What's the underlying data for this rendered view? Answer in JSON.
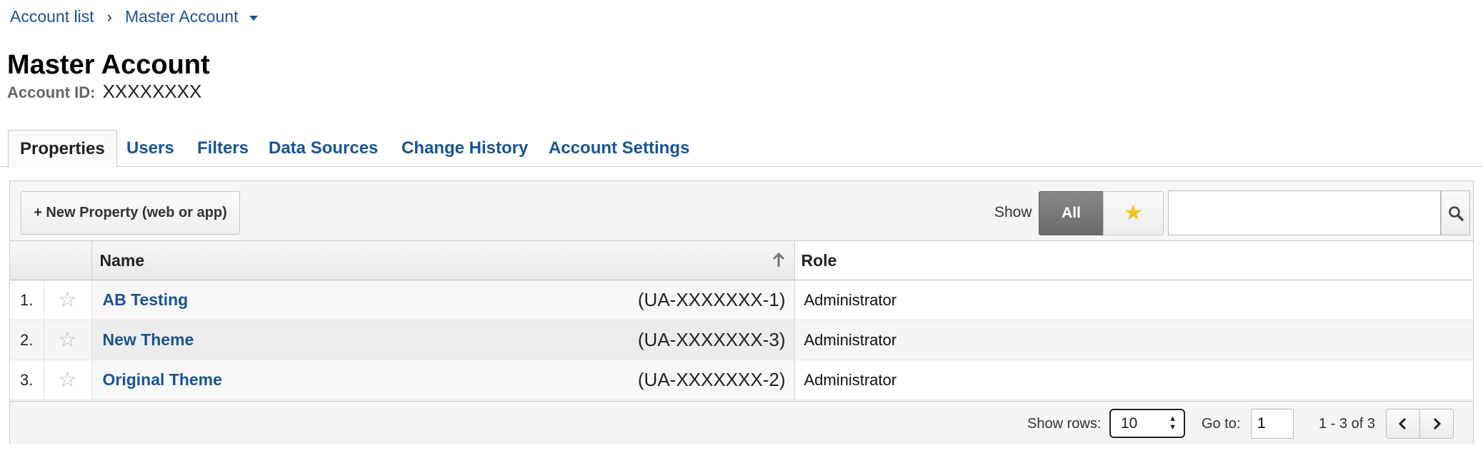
{
  "breadcrumb": {
    "account_list": "Account list",
    "separator": "›",
    "current": "Master Account"
  },
  "header": {
    "title": "Master Account",
    "account_id_label": "Account ID:",
    "account_id_value": "XXXXXXXX"
  },
  "tabs": [
    {
      "label": "Properties",
      "active": true
    },
    {
      "label": "Users",
      "active": false
    },
    {
      "label": "Filters",
      "active": false
    },
    {
      "label": "Data Sources",
      "active": false
    },
    {
      "label": "Change History",
      "active": false
    },
    {
      "label": "Account Settings",
      "active": false
    }
  ],
  "toolbar": {
    "new_property_label": "+ New Property (web or app)",
    "show_label": "Show",
    "all_label": "All",
    "star_icon": "star-icon",
    "search_placeholder": "",
    "search_icon": "search-icon"
  },
  "table": {
    "columns": {
      "name": "Name",
      "role": "Role"
    },
    "sort_icon": "arrow-up-icon",
    "rows": [
      {
        "num": "1.",
        "name": "AB Testing",
        "id": "(UA-XXXXXXX-1)",
        "role": "Administrator"
      },
      {
        "num": "2.",
        "name": "New Theme",
        "id": "(UA-XXXXXXX-3)",
        "role": "Administrator"
      },
      {
        "num": "3.",
        "name": "Original Theme",
        "id": "(UA-XXXXXXX-2)",
        "role": "Administrator"
      }
    ]
  },
  "footer": {
    "show_rows_label": "Show rows:",
    "show_rows_value": "10",
    "goto_label": "Go to:",
    "goto_value": "1",
    "range_text": "1 - 3 of 3"
  },
  "colors": {
    "link": "#1a5494",
    "accent_star": "#f0c419",
    "active_toggle": "#6b6b6b"
  }
}
